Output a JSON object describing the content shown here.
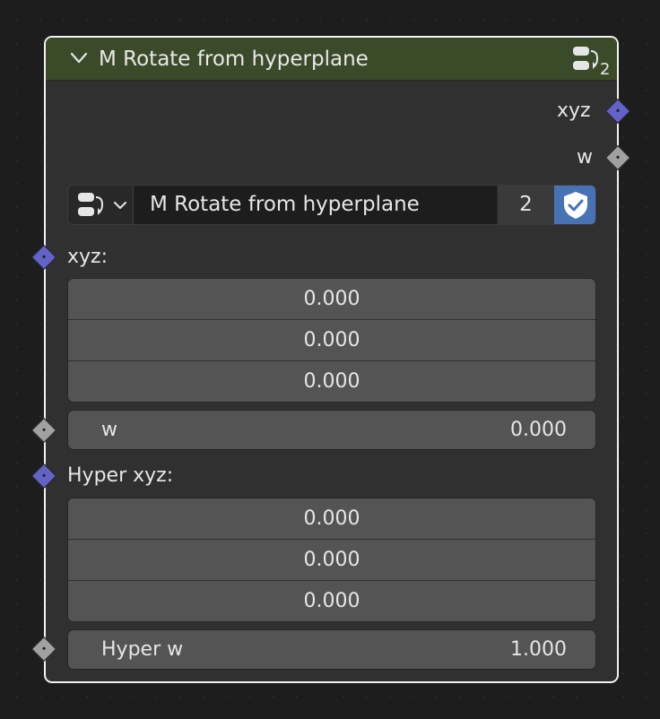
{
  "node": {
    "title": "M Rotate from hyperplane",
    "user_count": "2",
    "header_icon": "node-group-icon",
    "collapse_icon": "chevron-down-icon"
  },
  "outputs": [
    {
      "label": "xyz",
      "socket": "vector"
    },
    {
      "label": "w",
      "socket": "value"
    }
  ],
  "group_selector": {
    "icon": "node-group-icon",
    "dropdown_icon": "chevron-down-icon",
    "name": "M Rotate from hyperplane",
    "users": "2",
    "fake_user_icon": "shield-check-icon"
  },
  "inputs": {
    "xyz": {
      "label": "xyz:",
      "values": [
        "0.000",
        "0.000",
        "0.000"
      ]
    },
    "w": {
      "label": "w",
      "value": "0.000"
    },
    "hyper_xyz": {
      "label": "Hyper xyz:",
      "values": [
        "0.000",
        "0.000",
        "0.000"
      ]
    },
    "hyper_w": {
      "label": "Hyper w",
      "value": "1.000"
    }
  },
  "colors": {
    "header": "#3b4b2a",
    "node_body": "#303030",
    "vector_socket": "#6363c7",
    "value_socket": "#a1a1a1",
    "field": "#545454",
    "accent": "#4772b3"
  }
}
